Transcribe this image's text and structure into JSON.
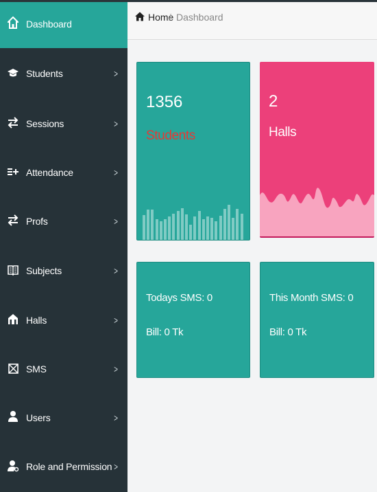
{
  "sidebar": {
    "items": [
      {
        "label": "Dashboard",
        "icon": "home-icon",
        "active": true
      },
      {
        "label": "Students",
        "icon": "graduation-cap-icon"
      },
      {
        "label": "Sessions",
        "icon": "exchange-icon"
      },
      {
        "label": "Attendance",
        "icon": "list-plus-icon"
      },
      {
        "label": "Profs",
        "icon": "exchange-icon"
      },
      {
        "label": "Subjects",
        "icon": "book-icon"
      },
      {
        "label": "Halls",
        "icon": "building-icon"
      },
      {
        "label": "SMS",
        "icon": "envelope-icon"
      },
      {
        "label": "Users",
        "icon": "user-icon"
      },
      {
        "label": "Role and Permission",
        "icon": "user-key-icon"
      }
    ]
  },
  "breadcrumb": {
    "home": "Home",
    "separator": "/",
    "current": "Dashboard"
  },
  "cards": {
    "students": {
      "count": "1356",
      "label": "Students",
      "color": "#26a69a",
      "label_color": "#e53935"
    },
    "halls": {
      "count": "2",
      "label": "Halls",
      "color": "#ec407a"
    },
    "sms_today": {
      "sms": "Todays SMS: 0",
      "bill": "Bill: 0 Tk"
    },
    "sms_month": {
      "sms": "This Month SMS: 0",
      "bill": "Bill: 0 Tk"
    }
  },
  "sparkline": [
    0.45,
    0.55,
    0.55,
    0.38,
    0.34,
    0.38,
    0.42,
    0.48,
    0.52,
    0.57,
    0.46,
    0.28,
    0.42,
    0.52,
    0.38,
    0.42,
    0.4,
    0.34,
    0.44,
    0.56,
    0.64,
    0.4,
    0.56,
    0.48
  ],
  "colors": {
    "sidebar": "#263238",
    "accent": "#26a69a",
    "pink": "#ec407a"
  }
}
